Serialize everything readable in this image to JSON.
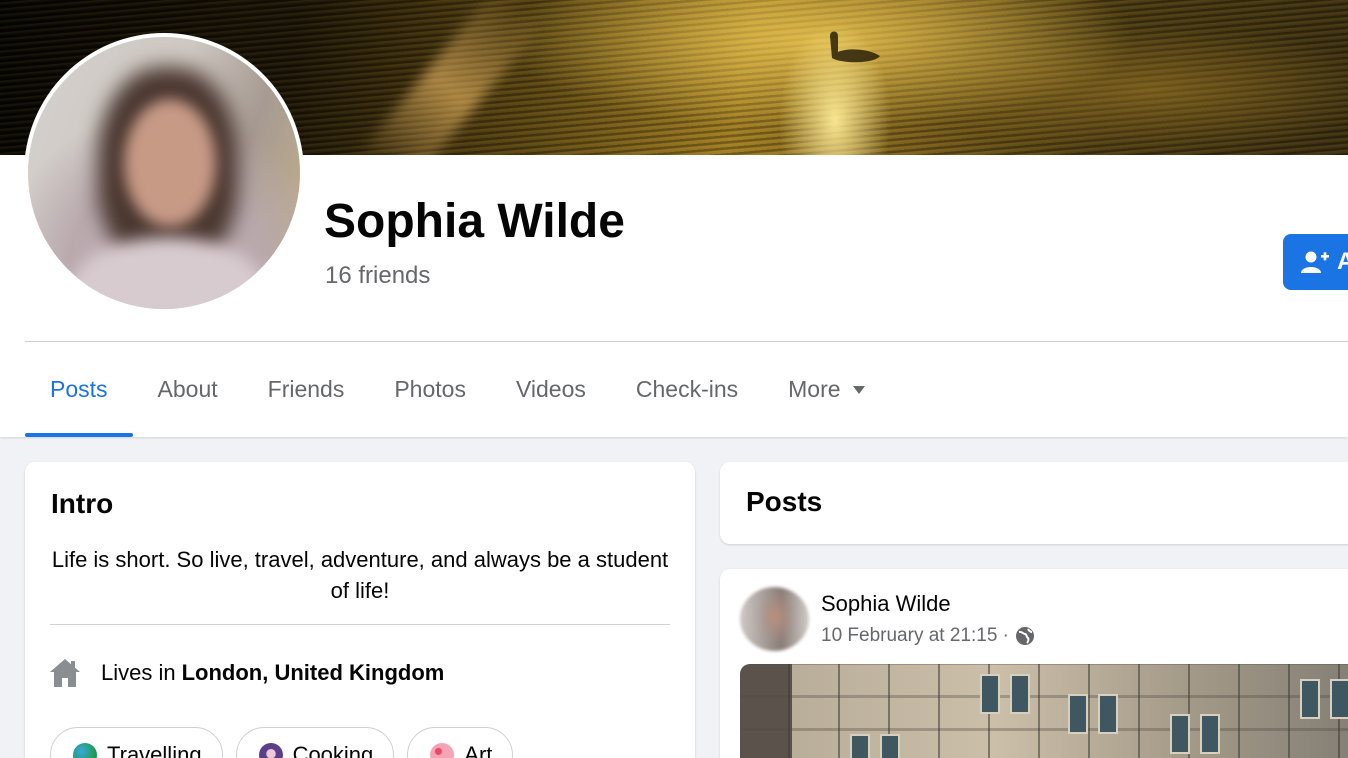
{
  "profile": {
    "name": "Sophia Wilde",
    "friends": "16 friends",
    "add_button_label": "A"
  },
  "tabs": [
    {
      "label": "Posts",
      "active": true
    },
    {
      "label": "About"
    },
    {
      "label": "Friends"
    },
    {
      "label": "Photos"
    },
    {
      "label": "Videos"
    },
    {
      "label": "Check-ins"
    },
    {
      "label": "More"
    }
  ],
  "intro": {
    "title": "Intro",
    "bio": "Life is short. So live, travel, adventure, and always be a student of life!",
    "lives_prefix": "Lives in",
    "lives_location": "London, United Kingdom",
    "hobbies": [
      {
        "label": "Travelling",
        "icon": "globe-icon",
        "color": "#1f9d55"
      },
      {
        "label": "Cooking",
        "icon": "pin-icon",
        "color": "#5b3f8a"
      },
      {
        "label": "Art",
        "icon": "palette-icon",
        "color": "#f5a3b5"
      }
    ]
  },
  "posts": {
    "title": "Posts",
    "items": [
      {
        "author": "Sophia Wilde",
        "timestamp": "10 February at 21:15 ·",
        "privacy_icon": "globe-icon"
      }
    ]
  },
  "colors": {
    "accent": "#1b74e4",
    "muted_text": "#65676b",
    "background": "#f0f2f5"
  }
}
